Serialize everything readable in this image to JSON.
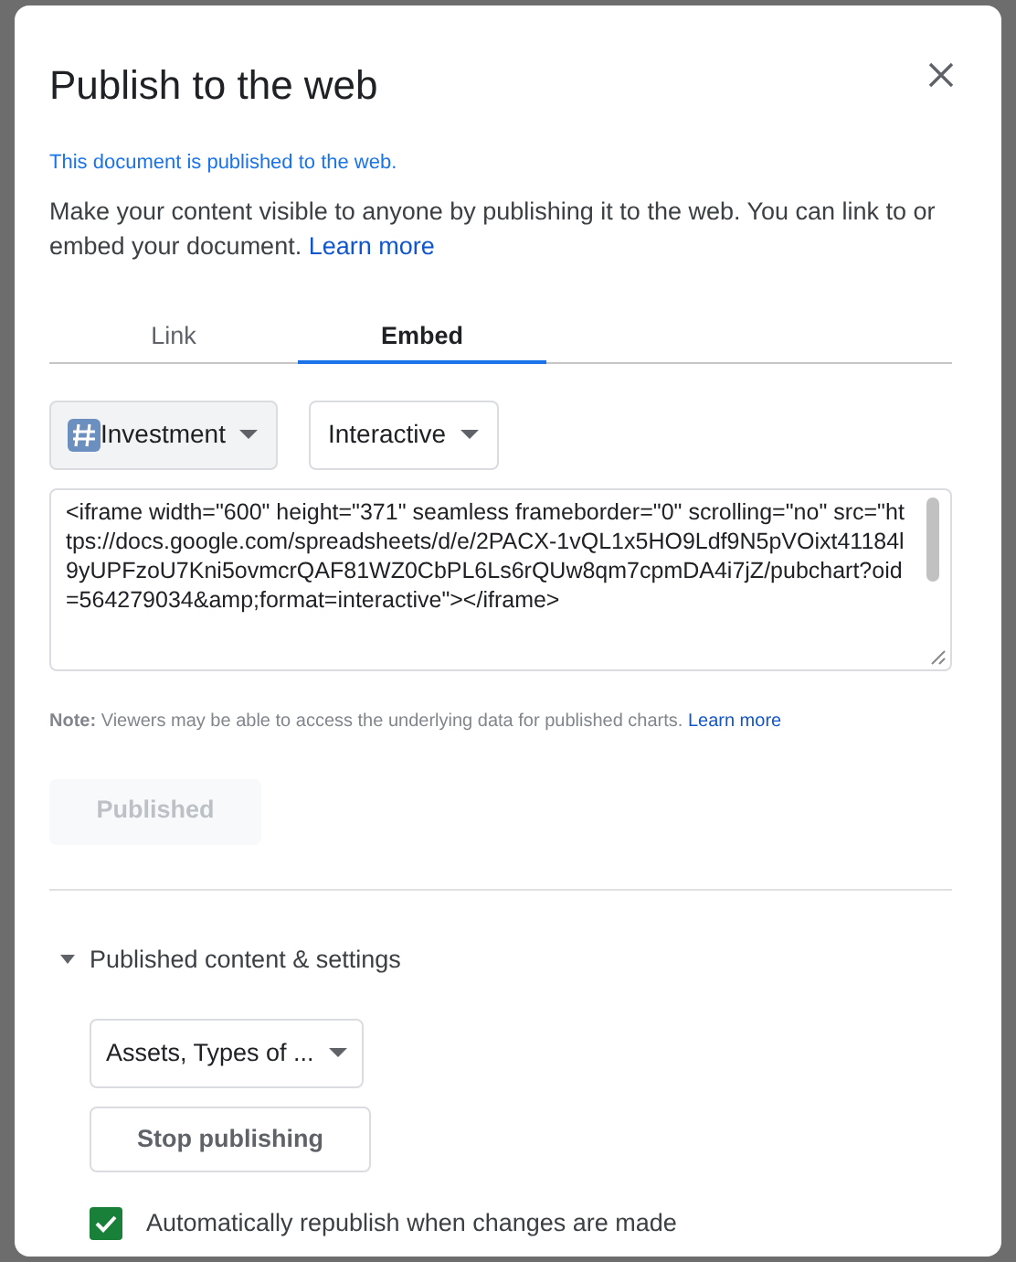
{
  "dialog": {
    "title": "Publish to the web",
    "status": "This document is published to the web.",
    "description": "Make your content visible to anyone by publishing it to the web. You can link to or embed your document.",
    "description_link": "Learn more"
  },
  "tabs": [
    {
      "label": "Link",
      "selected": false
    },
    {
      "label": "Embed",
      "selected": true
    }
  ],
  "embed": {
    "sheet_dropdown": {
      "label": "Investment",
      "selected": true
    },
    "format_dropdown": {
      "label": "Interactive",
      "selected": false
    },
    "code": "<iframe width=\"600\" height=\"371\" seamless frameborder=\"0\" scrolling=\"no\" src=\"https://docs.google.com/spreadsheets/d/e/2PACX-1vQL1x5HO9Ldf9N5pVOixt41184l9yUPFzoU7Kni5ovmcrQAF81WZ0CbPL6Ls6rQUw8qm7cpmDA4i7jZ/pubchart?oid=564279034&amp;format=interactive\"></iframe>",
    "note": "**Note:** Viewers may be able to access the underlying data for published charts.",
    "note_link": "Learn more",
    "publish_button": {
      "label": "Published",
      "disabled": true
    }
  },
  "settings": {
    "header": "Published content & settings",
    "expanded": true,
    "content_dropdown": "Assets, Types of ...",
    "stop_button": "Stop publishing",
    "auto_republish": {
      "label": "Automatically republish when changes are made",
      "checked": true
    }
  }
}
